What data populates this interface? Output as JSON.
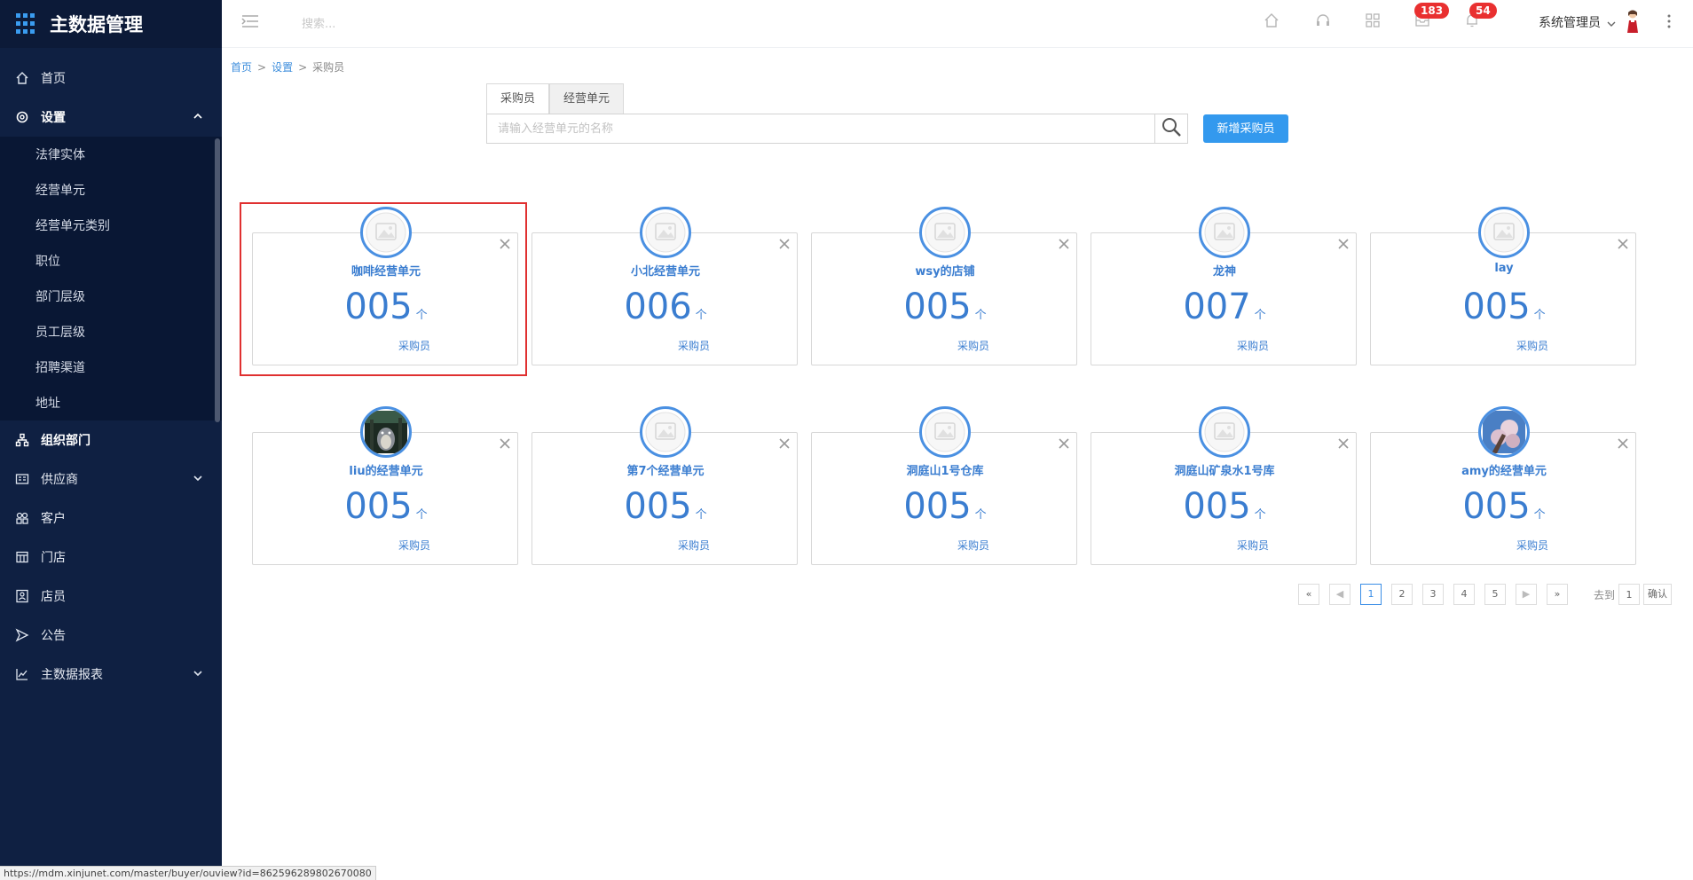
{
  "app": {
    "title": "主数据管理"
  },
  "sidebar": {
    "items": [
      {
        "label": "首页",
        "icon": "home-icon"
      },
      {
        "label": "设置",
        "icon": "gear-icon",
        "expanded": true
      },
      {
        "label": "组织部门",
        "icon": "org-icon"
      },
      {
        "label": "供应商",
        "icon": "supplier-icon"
      },
      {
        "label": "客户",
        "icon": "customer-icon"
      },
      {
        "label": "门店",
        "icon": "store-icon"
      },
      {
        "label": "店员",
        "icon": "clerk-icon"
      },
      {
        "label": "公告",
        "icon": "announcement-icon"
      },
      {
        "label": "主数据报表",
        "icon": "report-icon"
      }
    ],
    "settings_sub": [
      "法律实体",
      "经营单元",
      "经营单元类别",
      "职位",
      "部门层级",
      "员工层级",
      "招聘渠道",
      "地址"
    ]
  },
  "header": {
    "search_placeholder": "搜索...",
    "mail_badge": "183",
    "bell_badge": "54",
    "user_name": "系统管理员"
  },
  "breadcrumb": {
    "home": "首页",
    "settings": "设置",
    "current": "采购员",
    "sep": ">"
  },
  "tabs": [
    {
      "label": "采购员",
      "active": false
    },
    {
      "label": "经营单元",
      "active": true
    }
  ],
  "search": {
    "placeholder": "请输入经营单元的名称",
    "add_label": "新增采购员"
  },
  "cards": [
    {
      "name": "咖啡经营单元",
      "count": "005",
      "unit": "个",
      "label": "采购员",
      "avatar": "placeholder-image-icon",
      "selected": true
    },
    {
      "name": "小北经营单元",
      "count": "006",
      "unit": "个",
      "label": "采购员",
      "avatar": "placeholder-image-icon"
    },
    {
      "name": "wsy的店铺",
      "count": "005",
      "unit": "个",
      "label": "采购员",
      "avatar": "placeholder-image-icon"
    },
    {
      "name": "龙神",
      "count": "007",
      "unit": "个",
      "label": "采购员",
      "avatar": "placeholder-image-icon"
    },
    {
      "name": "lay",
      "count": "005",
      "unit": "个",
      "label": "采购员",
      "avatar": "placeholder-image-icon"
    },
    {
      "name": "liu的经营单元",
      "count": "005",
      "unit": "个",
      "label": "采购员",
      "avatar": "totoro-photo-icon"
    },
    {
      "name": "第7个经营单元",
      "count": "005",
      "unit": "个",
      "label": "采购员",
      "avatar": "placeholder-image-icon"
    },
    {
      "name": "洞庭山1号仓库",
      "count": "005",
      "unit": "个",
      "label": "采购员",
      "avatar": "placeholder-image-icon"
    },
    {
      "name": "洞庭山矿泉水1号库",
      "count": "005",
      "unit": "个",
      "label": "采购员",
      "avatar": "placeholder-image-icon"
    },
    {
      "name": "amy的经营单元",
      "count": "005",
      "unit": "个",
      "label": "采购员",
      "avatar": "blossom-photo-icon"
    }
  ],
  "pagination": {
    "first": "«",
    "prev": "◀",
    "pages": [
      "1",
      "2",
      "3",
      "4",
      "5"
    ],
    "current": "1",
    "next": "▶",
    "last": "»",
    "goto_label": "去到",
    "goto_value": "1",
    "confirm": "确认"
  },
  "status_url": "https://mdm.xinjunet.com/master/buyer/ouview?id=862596289802670080",
  "colors": {
    "sidebar_bg": "#0f2042",
    "accent": "#3399ee",
    "badge": "#e93030",
    "card_text": "#3a7dd0",
    "selection": "#e03030"
  }
}
